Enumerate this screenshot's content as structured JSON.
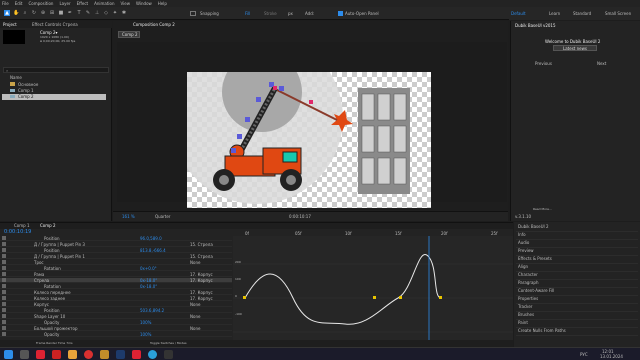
{
  "menu": [
    "File",
    "Edit",
    "Composition",
    "Layer",
    "Effect",
    "Animation",
    "View",
    "Window",
    "Help"
  ],
  "toolbar": {
    "snapping": "Snapping",
    "fill": "Fill",
    "stroke": "Stroke",
    "px": "px",
    "add": "Add:",
    "auto_open": "Auto-Open Panel"
  },
  "workspaces": [
    "Default",
    "Learn",
    "Standard",
    "Small Screen"
  ],
  "project": {
    "tab_project": "Project",
    "tab_effects": "Effect Controls Стрела",
    "comp_name": "Comp 2▾",
    "comp_info1": "1920 x 1080 (1.00)",
    "comp_info2": "Δ 0;00;20;00, 25.00 fps",
    "search_placeholder": "",
    "col_name": "Name",
    "items": [
      "Основное",
      "Comp 1",
      "Comp 2"
    ]
  },
  "viewer": {
    "tab": "Composition Comp 2",
    "comp_tab": "Comp 2",
    "zoom": "161 %",
    "quality": "Quarter",
    "timecode": "0:00:10:17"
  },
  "dubik": {
    "title": "Dubik BaseUI v2015",
    "welcome": "Welcome to Dubik BaseUI 2",
    "latest": "Latest news",
    "prev": "Previous",
    "next": "Next",
    "read_more": "Read More...",
    "version": "v.3.1.10"
  },
  "right_panels": [
    "Dubik BaseUI 2",
    "Info",
    "Audio",
    "Preview",
    "Effects & Presets",
    "Align",
    "Character",
    "Paragraph",
    "Content-Aware Fill",
    "Properties",
    "Tracker",
    "Brushes",
    "Paint",
    "Create Nulls From Paths"
  ],
  "timeline": {
    "tabs": [
      "Comp 1",
      "Comp 2"
    ],
    "timecode": "0:00:10:19",
    "col_layer": "Layer Name",
    "col_parent": "Parent & Link",
    "ruler": [
      "0f",
      "05f",
      "10f",
      "15f",
      "20f",
      "25f"
    ],
    "graph_labels": [
      "200",
      "100",
      "0",
      "-100"
    ],
    "rows": [
      {
        "name": "Position",
        "value": "96.0,589.0",
        "parent": ""
      },
      {
        "name": "Д / Группа | Puppet Pin 3",
        "value": "",
        "parent": "15. Стрела"
      },
      {
        "name": "Position",
        "value": "813.8,-666.4",
        "parent": ""
      },
      {
        "name": "Д / Группа | Puppet Pin 1",
        "value": "",
        "parent": "15. Стрела"
      },
      {
        "name": "Трос",
        "value": "",
        "parent": "None"
      },
      {
        "name": "Rotation",
        "value": "0x+0.0°",
        "parent": ""
      },
      {
        "name": "Рама",
        "value": "",
        "parent": "17. Корпус"
      },
      {
        "name": "Стрела",
        "value": "0x-18.0°",
        "parent": "17. Корпус"
      },
      {
        "name": "Rotation",
        "value": "0x-18.0°",
        "parent": ""
      },
      {
        "name": "Колесо переднее",
        "value": "",
        "parent": "17. Корпус"
      },
      {
        "name": "Колесо заднее",
        "value": "",
        "parent": "17. Корпус"
      },
      {
        "name": "Корпус",
        "value": "",
        "parent": "None"
      },
      {
        "name": "Position",
        "value": "503.6,894.2",
        "parent": ""
      },
      {
        "name": "Shape Layer 10",
        "value": "",
        "parent": "None"
      },
      {
        "name": "Opacity",
        "value": "100%",
        "parent": ""
      },
      {
        "name": "Большой прожектор",
        "value": "",
        "parent": "None"
      },
      {
        "name": "Opacity",
        "value": "100%",
        "parent": ""
      }
    ],
    "footer": "Frame Render Time 7ms",
    "toggle": "Toggle Switches / Modes"
  },
  "taskbar": {
    "lang": "РУС",
    "time": "12:01",
    "date": "13.01.2024"
  }
}
